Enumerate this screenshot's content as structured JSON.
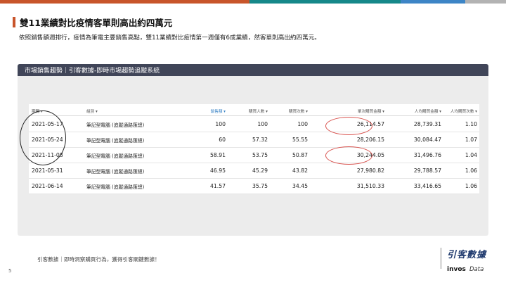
{
  "slide": {
    "title": "雙11業績對比疫情客單則高出約四萬元",
    "subtitle": "依照銷售額週排行，疫情為筆電主要銷售高點，雙11業績對比疫情第一週僅有6成業績，然客單則高出約四萬元。",
    "page_number": "5",
    "footer": "引客數據｜即時洞察購買行為，獲得引客關鍵數據！",
    "accent_color": "#c8552b"
  },
  "panel": {
    "title": "市場銷售趨勢｜引客數據-即時市場趨勢追蹤系統"
  },
  "table": {
    "headers": [
      "期間 ▾",
      "組別 ▾",
      "銷售額 ▾",
      "購買人數 ▾",
      "購買次數 ▾",
      "單次購買金額 ▾",
      "人均購買金額 ▾",
      "人均購買次數 ▾"
    ],
    "rows": [
      [
        "2021-05-17",
        "筆記型電腦 (追蹤通路匯總)",
        "100",
        "100",
        "100",
        "26,114.57",
        "28,739.31",
        "1.10"
      ],
      [
        "2021-05-24",
        "筆記型電腦 (追蹤通路匯總)",
        "60",
        "57.32",
        "55.55",
        "28,206.15",
        "30,084.47",
        "1.07"
      ],
      [
        "2021-11-08",
        "筆記型電腦 (追蹤通路匯總)",
        "58.91",
        "53.75",
        "50.87",
        "30,244.05",
        "31,496.76",
        "1.04"
      ],
      [
        "2021-05-31",
        "筆記型電腦 (追蹤通路匯總)",
        "46.95",
        "45.29",
        "43.82",
        "27,980.82",
        "29,788.57",
        "1.06"
      ],
      [
        "2021-06-14",
        "筆記型電腦 (追蹤通路匯總)",
        "41.57",
        "35.75",
        "34.45",
        "31,510.33",
        "33,416.65",
        "1.06"
      ]
    ]
  },
  "logo": {
    "main": "引客數據",
    "brand": "invos",
    "suffix": "Data"
  },
  "colors": {
    "top_bar": [
      "#c8552b",
      "#16888a",
      "#3d85c6",
      "#b3b3b3"
    ],
    "panel_header": "#404558",
    "highlight_circle": "#d9534f"
  }
}
